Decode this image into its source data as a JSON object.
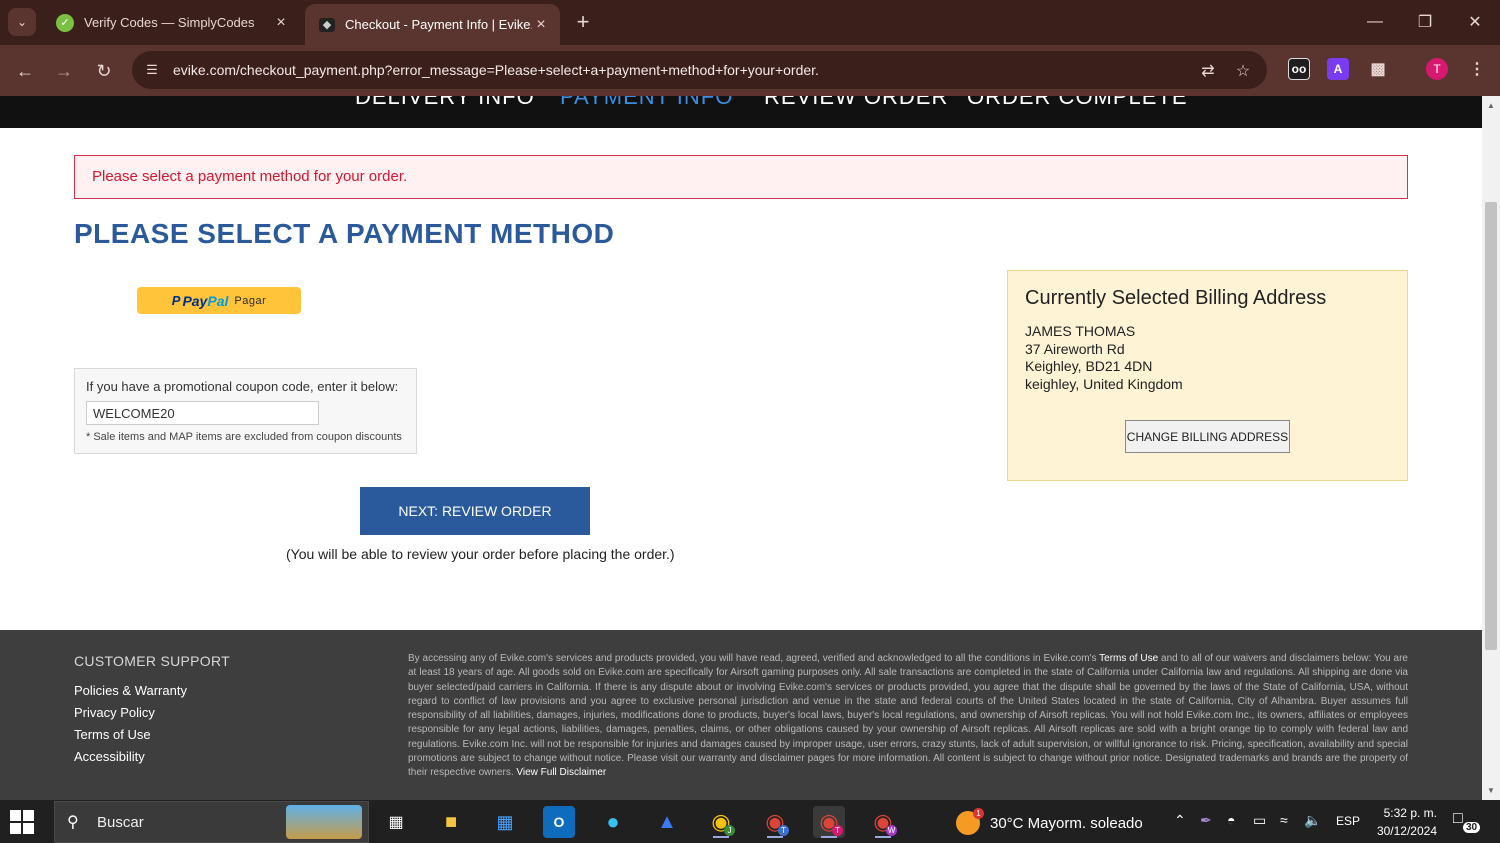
{
  "browser": {
    "tabs": [
      {
        "title": "Verify Codes — SimplyCodes",
        "active": false
      },
      {
        "title": "Checkout - Payment Info | Evike.com",
        "active": true
      }
    ],
    "url": "evike.com/checkout_payment.php?error_message=Please+select+a+payment+method+for+your+order.",
    "profile_initial": "T",
    "extension_a_label": "A",
    "extension_oo_label": "oo"
  },
  "steps": [
    {
      "label": "DELIVERY INFO",
      "active": false
    },
    {
      "label": "PAYMENT INFO",
      "active": true
    },
    {
      "label": "REVIEW ORDER",
      "active": false
    },
    {
      "label": "ORDER COMPLETE",
      "active": false
    }
  ],
  "error": {
    "message": "Please select a payment method for your order."
  },
  "heading": "PLEASE SELECT A PAYMENT METHOD",
  "paypal": {
    "brand_pay": "Pay",
    "brand_pal": "Pal",
    "brand_mark": "P",
    "label": "Pagar"
  },
  "coupon": {
    "label": "If you have a promotional coupon code, enter it below:",
    "value": "WELCOME20",
    "note": "* Sale items and MAP items are excluded from coupon discounts"
  },
  "next_button": {
    "label": "NEXT: REVIEW ORDER"
  },
  "review_note": "(You will be able to review your order before placing the order.)",
  "billing": {
    "title": "Currently Selected Billing Address",
    "lines": [
      "JAMES THOMAS",
      "37 Aireworth Rd",
      "Keighley, BD21 4DN",
      "keighley, United Kingdom"
    ],
    "change_button": "CHANGE BILLING ADDRESS"
  },
  "footer": {
    "heading": "CUSTOMER SUPPORT",
    "links": [
      "Policies & Warranty",
      "Privacy Policy",
      "Terms of Use",
      "Accessibility"
    ],
    "disclaimer_part1": "By accessing any of Evike.com's services and products provided, you will have read, agreed, verified and acknowledged to all the conditions in Evike.com's ",
    "disclaimer_link1": "Terms of Use",
    "disclaimer_part2": " and to all of our waivers and disclaimers below: You are at least 18 years of age. All goods sold on Evike.com are specifically for Airsoft gaming purposes only. All sale transactions are completed in the state of California under California law and regulations. All shipping are done via buyer selected/paid carriers in California. If there is any dispute about or involving Evike.com's services or products provided, you agree that the dispute shall be governed by the laws of the State of California, USA, without regard to conflict of law provisions and you agree to exclusive personal jurisdiction and venue in the state and federal courts of the United States located in the state of California, City of Alhambra. Buyer assumes full responsibility of all liabilities, damages, injuries, modifications done to products, buyer's local laws, buyer's local regulations, and ownership of Airsoft replicas. You will not hold Evike.com Inc., its owners, affiliates or employees responsible for any legal actions, liabilities, damages, penalties, claims, or other obligations caused by your ownership of Airsoft replicas. All Airsoft replicas are sold with a bright orange tip to comply with federal law and regulations. Evike.com Inc. will not be responsible for injuries and damages caused by improper usage, user errors, crazy stunts, lack of adult supervision, or willful ignorance to risk. Pricing, specification, availability and special promotions are subject to change without notice. Please visit our warranty and disclaimer pages for more information. All content is subject to change without prior notice. Designated trademarks and brands are the property of their respective owners. ",
    "disclaimer_link2": "View Full Disclaimer"
  },
  "taskbar": {
    "search_placeholder": "Buscar",
    "weather": "30°C  Mayorm. soleado",
    "language": "ESP",
    "time": "5:32 p. m.",
    "date": "30/12/2024",
    "notification_count": "30",
    "weather_badge": "1",
    "chrome_profile_letters": [
      "J",
      "T",
      "T",
      "W"
    ]
  }
}
